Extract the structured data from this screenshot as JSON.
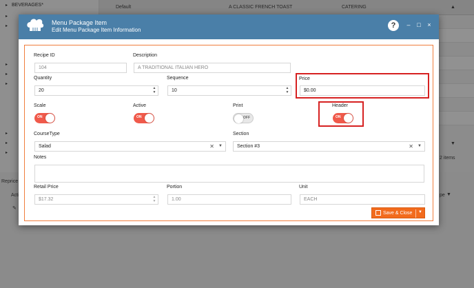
{
  "background": {
    "sidebar": [
      "BEVERAGES*"
    ],
    "grid_header": [
      "Default",
      "A CLASSIC FRENCH TOAST",
      "CATERING"
    ],
    "items_count": "2 items",
    "bottom_label": "Reprice I",
    "column_label": "Acti",
    "column_label_right": "pe"
  },
  "dialog": {
    "title": "Menu Package Item",
    "subtitle": "Edit Menu Package Item Information",
    "help": "?",
    "minimize": "–",
    "maximize": "□",
    "close": "×"
  },
  "form": {
    "recipe_id": {
      "label": "Recipe ID",
      "value": "104"
    },
    "description": {
      "label": "Description",
      "value": "A TRADITIONAL ITALIAN HERO"
    },
    "quantity": {
      "label": "Quantity",
      "value": "20"
    },
    "sequence": {
      "label": "Sequence",
      "value": "10"
    },
    "price": {
      "label": "Price",
      "value": "$0.00"
    },
    "scale": {
      "label": "Scale",
      "state": "ON"
    },
    "active": {
      "label": "Active",
      "state": "ON"
    },
    "print": {
      "label": "Print",
      "state": "OFF"
    },
    "header": {
      "label": "Header",
      "state": "ON"
    },
    "course_type": {
      "label": "CourseType",
      "value": "Salad"
    },
    "section": {
      "label": "Section",
      "value": "Section #3"
    },
    "notes": {
      "label": "Notes",
      "value": ""
    },
    "retail_price": {
      "label": "Retail Price",
      "value": "$17.32"
    },
    "portion": {
      "label": "Portion",
      "value": "1.00"
    },
    "unit": {
      "label": "Unit",
      "value": "EACH"
    },
    "save_button": "Save & Close"
  },
  "colors": {
    "titlebar": "#4a7fa8",
    "accent": "#f26b1d",
    "toggle_on": "#f05a4b",
    "highlight": "#d62020"
  }
}
